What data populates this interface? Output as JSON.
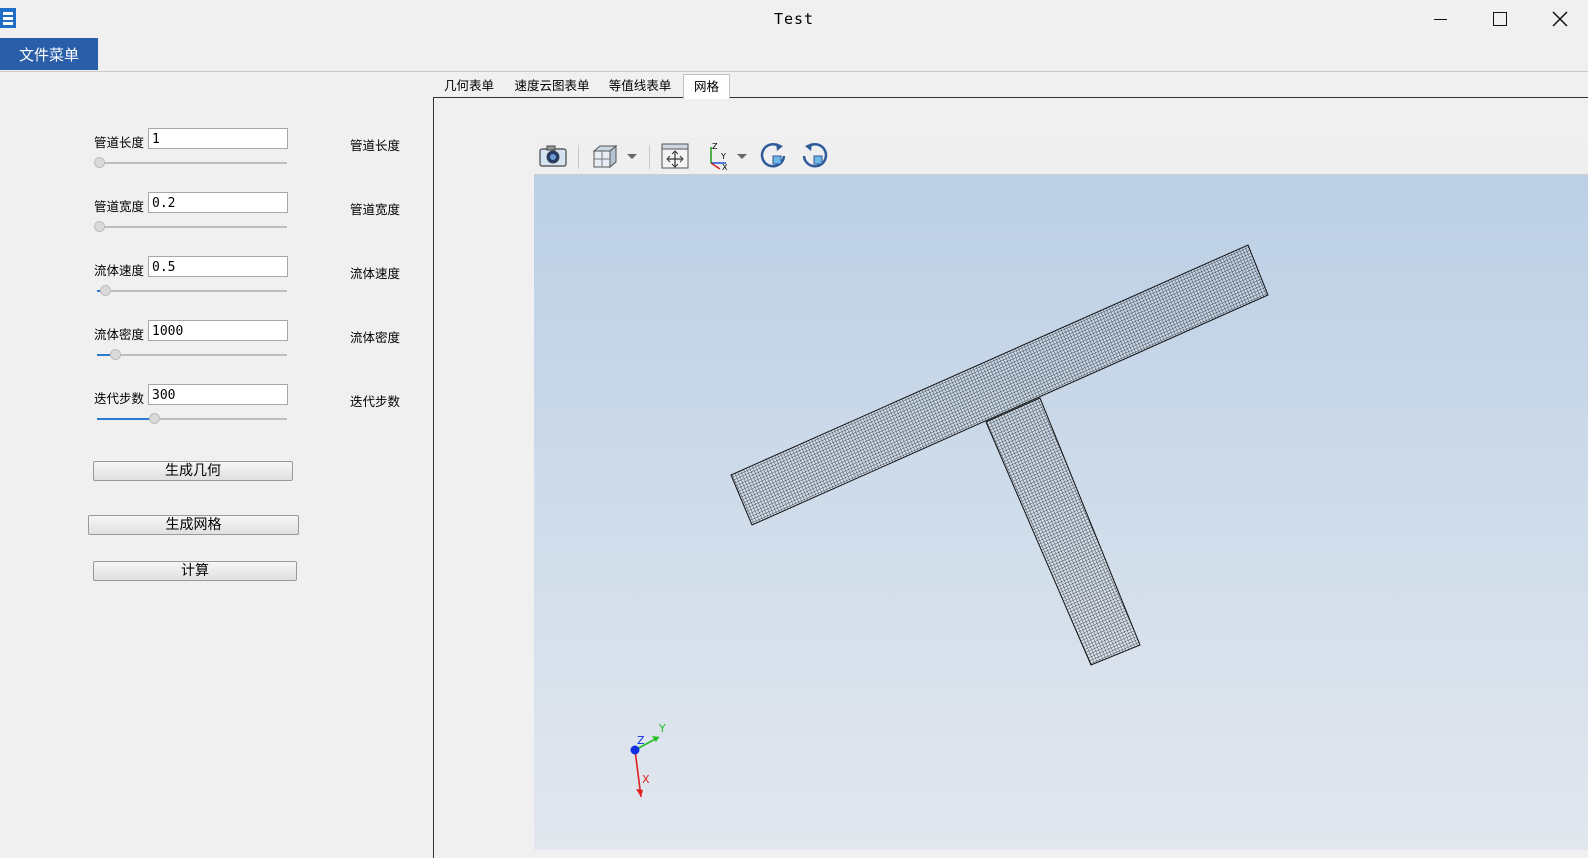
{
  "window": {
    "title": "Test",
    "controls": {
      "minimize": "minimize-icon",
      "maximize": "maximize-icon",
      "close": "close-icon"
    }
  },
  "menubar": {
    "file_menu": "文件菜单"
  },
  "tabs": [
    {
      "label": "几何表单",
      "active": false
    },
    {
      "label": "速度云图表单",
      "active": false
    },
    {
      "label": "等值线表单",
      "active": false
    },
    {
      "label": "网格",
      "active": true
    }
  ],
  "params": [
    {
      "label": "管道长度",
      "value": "1",
      "right_label": "管道长度",
      "slider_fraction": 0.0
    },
    {
      "label": "管道宽度",
      "value": "0.2",
      "right_label": "管道宽度",
      "slider_fraction": 0.0
    },
    {
      "label": "流体速度",
      "value": "0.5",
      "right_label": "流体速度",
      "slider_fraction": 0.04
    },
    {
      "label": "流体密度",
      "value": "1000",
      "right_label": "流体密度",
      "slider_fraction": 0.1
    },
    {
      "label": "迭代步数",
      "value": "300",
      "right_label": "迭代步数",
      "slider_fraction": 0.3
    }
  ],
  "buttons": {
    "generate_geometry": "生成几何",
    "generate_mesh": "生成网格",
    "compute": "计算"
  },
  "viewer": {
    "toolbar_icons": [
      "camera-icon",
      "cube-view-icon",
      "dropdown-icon",
      "fit-view-icon",
      "axes-icon",
      "dropdown-icon",
      "rotate-cw-icon",
      "rotate-ccw-icon"
    ],
    "axis_triad": {
      "x": "X",
      "y": "Y",
      "z": "Z"
    },
    "colors": {
      "x_axis": "#e02020",
      "y_axis": "#20c020",
      "z_axis": "#1030e0",
      "mesh": "#111111"
    }
  }
}
